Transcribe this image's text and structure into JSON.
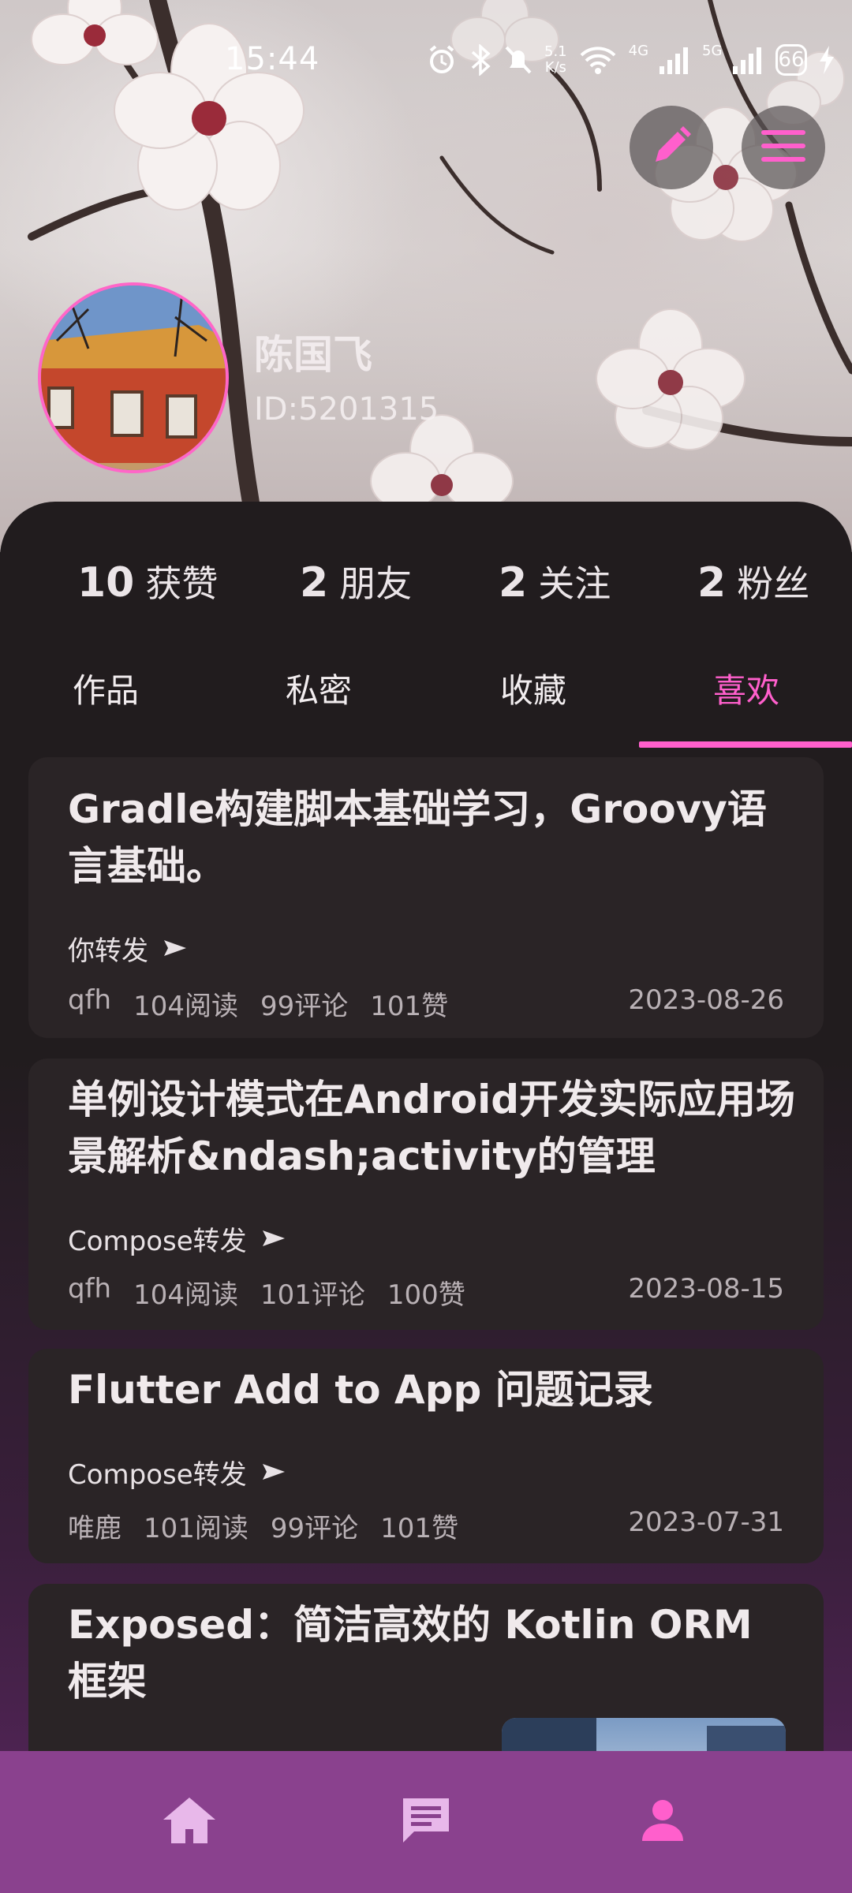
{
  "status_bar": {
    "time": "15:44",
    "net_speed_value": "5.1",
    "net_speed_unit": "K/s",
    "network_4g": "4G",
    "network_5g": "5G",
    "battery": "66"
  },
  "profile": {
    "name": "陈国飞",
    "id": "ID:5201315"
  },
  "stats": [
    {
      "num": "10",
      "label": "获赞"
    },
    {
      "num": "2",
      "label": "朋友"
    },
    {
      "num": "2",
      "label": "关注"
    },
    {
      "num": "2",
      "label": "粉丝"
    }
  ],
  "tabs": [
    {
      "label": "作品"
    },
    {
      "label": "私密"
    },
    {
      "label": "收藏"
    },
    {
      "label": "喜欢",
      "active": true
    }
  ],
  "articles": [
    {
      "title": "Gradle构建脚本基础学习，Groovy语言基础。",
      "repost": "你转发",
      "author": "qfh",
      "reads": "104阅读",
      "comments": "99评论",
      "likes": "101赞",
      "date": "2023-08-26"
    },
    {
      "title": "单例设计模式在Android开发实际应用场景解析&ndash;activity的管理",
      "repost": "Compose转发",
      "author": "qfh",
      "reads": "104阅读",
      "comments": "101评论",
      "likes": "100赞",
      "date": "2023-08-15"
    },
    {
      "title": "Flutter Add to App 问题记录",
      "repost": "Compose转发",
      "author": "唯鹿",
      "reads": "101阅读",
      "comments": "99评论",
      "likes": "101赞",
      "date": "2023-07-31"
    },
    {
      "title": "Exposed：简洁高效的 Kotlin ORM 框架"
    }
  ],
  "colors": {
    "accent": "#ff5fcc",
    "panel": "#211c1e",
    "card": "#2a2426",
    "bottom_nav": "#8a418e"
  },
  "icons": {
    "edit": "pencil-icon",
    "menu": "menu-icon",
    "home": "home-icon",
    "messages": "chat-icon",
    "profile": "person-icon",
    "repost": "send-arrow-icon"
  }
}
